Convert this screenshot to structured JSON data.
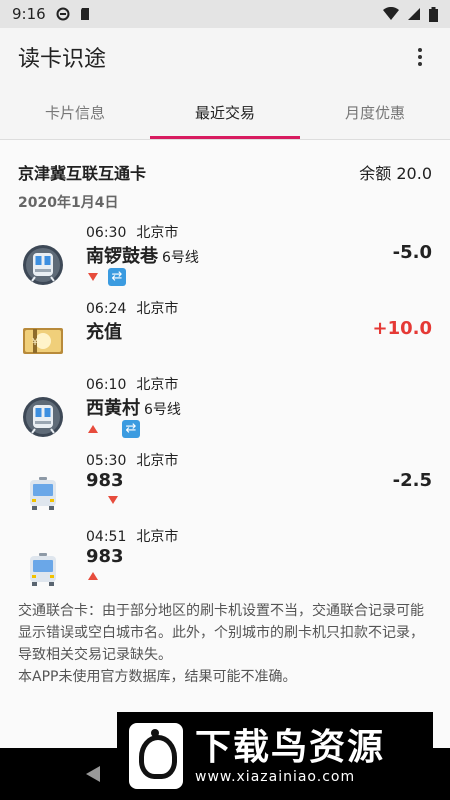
{
  "status_bar": {
    "time": "9:16"
  },
  "app": {
    "title": "读卡识途"
  },
  "tabs": [
    {
      "label": "卡片信息"
    },
    {
      "label": "最近交易"
    },
    {
      "label": "月度优惠"
    }
  ],
  "card": {
    "name": "京津冀互联互通卡",
    "balance": "余额 20.0"
  },
  "date": "2020年1月4日",
  "transactions": [
    {
      "time": "06:30",
      "city": "北京市",
      "station": "南锣鼓巷",
      "line": "6号线",
      "amount": "-5.0",
      "type": "metro",
      "direction": "down",
      "transfer": true
    },
    {
      "time": "06:24",
      "city": "北京市",
      "station": "充值",
      "line": "",
      "amount": "+10.0",
      "type": "topup",
      "direction": "",
      "transfer": false
    },
    {
      "time": "06:10",
      "city": "北京市",
      "station": "西黄村",
      "line": "6号线",
      "amount": "",
      "type": "metro",
      "direction": "up",
      "transfer": true
    },
    {
      "time": "05:30",
      "city": "北京市",
      "station": "983",
      "line": "",
      "amount": "-2.5",
      "type": "bus",
      "direction": "down",
      "transfer": false
    },
    {
      "time": "04:51",
      "city": "北京市",
      "station": "983",
      "line": "",
      "amount": "",
      "type": "bus",
      "direction": "up",
      "transfer": false
    }
  ],
  "note": {
    "line1": "交通联合卡：由于部分地区的刷卡机设置不当，交通联合记录可能显示错误或空白城市名。此外，个别城市的刷卡机只扣款不记录，导致相关交易记录缺失。",
    "line2": "本APP未使用官方数据库，结果可能不准确。"
  },
  "watermark": {
    "title": "下载鸟资源",
    "url": "www.xiazainiao.com"
  }
}
